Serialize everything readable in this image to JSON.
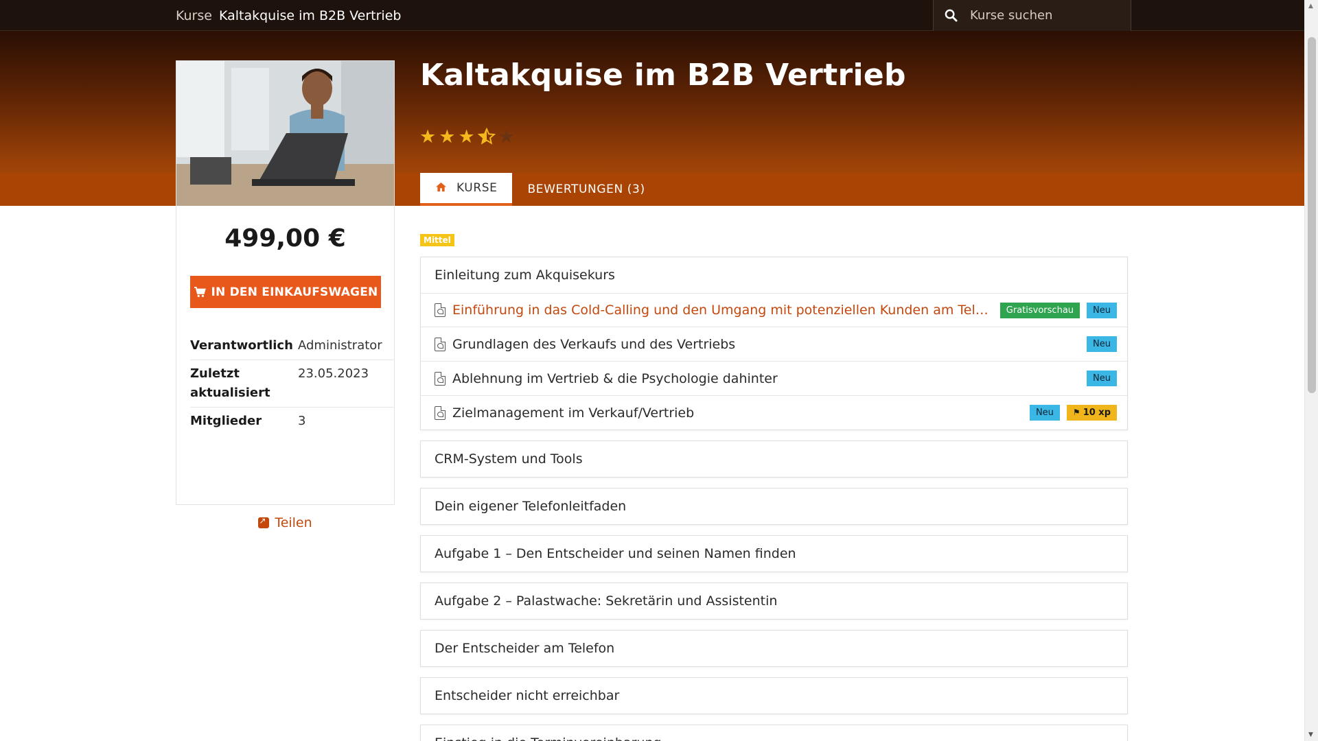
{
  "topbar": {
    "breadcrumb_root": "Kurse",
    "breadcrumb_current": "Kaltakquise im B2B Vertrieb",
    "search_placeholder": "Kurse suchen"
  },
  "course": {
    "title": "Kaltakquise im B2B Vertrieb",
    "rating": 3.5,
    "rating_max": 5
  },
  "tabs": [
    {
      "label": "KURSE",
      "active": true
    },
    {
      "label": "BEWERTUNGEN (3)",
      "active": false
    }
  ],
  "sidebar": {
    "price": "499,00 €",
    "cart_button_label": "IN DEN EINKAUFSWAGEN",
    "meta": [
      {
        "label": "Verantwortlich",
        "value": "Administrator"
      },
      {
        "label": "Zuletzt aktualisiert",
        "value": "23.05.2023"
      },
      {
        "label": "Mitglieder",
        "value": "3"
      }
    ],
    "share_label": "Teilen"
  },
  "level_badge": "Mittel",
  "sections": [
    {
      "title": "Einleitung zum Akquisekurs",
      "lessons": [
        {
          "title": "Einführung in das Cold-Calling und den Umgang mit potenziellen Kunden am Telefon",
          "badges": [
            "Gratisvorschau",
            "Neu"
          ],
          "preview": true
        },
        {
          "title": "Grundlagen des Verkaufs und des Vertriebs",
          "badges": [
            "Neu"
          ]
        },
        {
          "title": "Ablehnung im Vertrieb & die Psychologie dahinter",
          "badges": [
            "Neu"
          ]
        },
        {
          "title": "Zielmanagement im Verkauf/Vertrieb",
          "badges": [
            "Neu"
          ],
          "xp": "10 xp"
        }
      ]
    },
    {
      "title": "CRM-System und Tools"
    },
    {
      "title": "Dein eigener Telefonleitfaden"
    },
    {
      "title": "Aufgabe 1 – Den Entscheider und seinen Namen finden"
    },
    {
      "title": "Aufgabe 2 – Palastwache: Sekretärin und Assistentin"
    },
    {
      "title": "Der Entscheider am Telefon"
    },
    {
      "title": "Entscheider nicht erreichbar"
    },
    {
      "title": "Einstieg in die Terminvereinbarung"
    }
  ],
  "colors": {
    "accent": "#e8581a",
    "link": "#c4470c",
    "star": "#f4b81d",
    "badge_new": "#3bb7e6",
    "badge_free": "#2ea44f",
    "badge_xp": "#f0b51a",
    "badge_level": "#f4c416"
  },
  "icons": {
    "search": "search-icon",
    "home": "home-icon",
    "cart": "cart-icon",
    "share": "share-icon",
    "lesson": "pdf-file-icon",
    "xp": "flag-icon"
  }
}
